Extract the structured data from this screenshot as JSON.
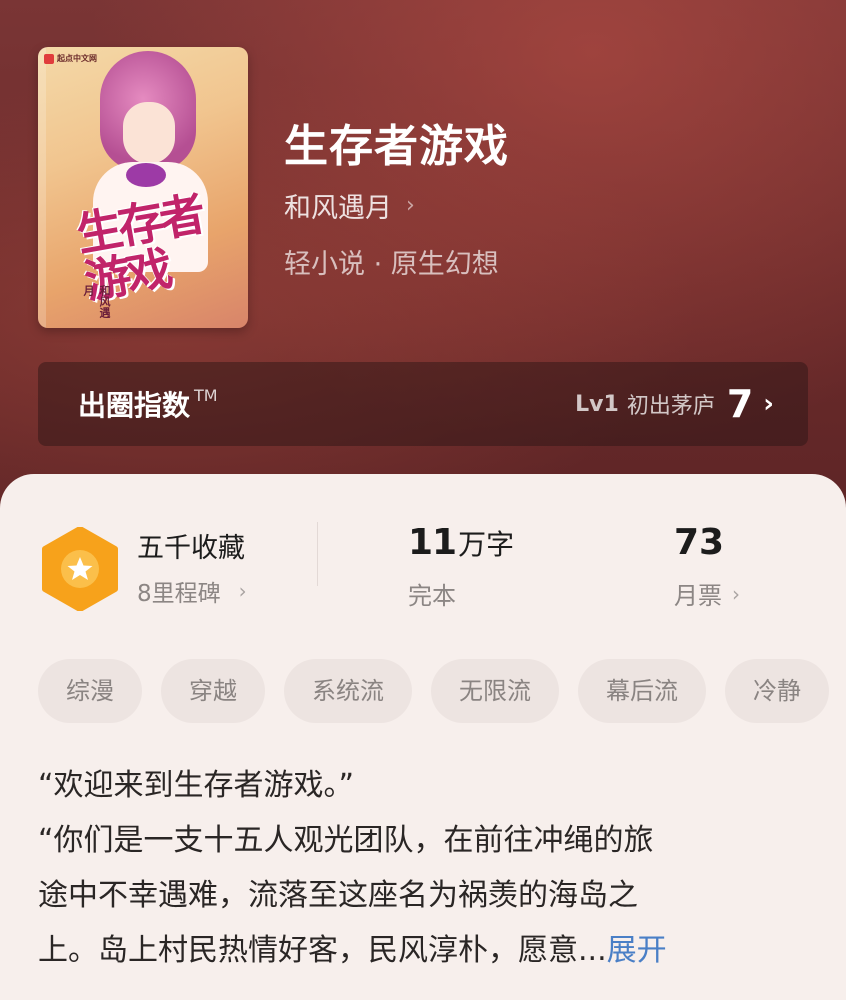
{
  "book": {
    "title": "生存者游戏",
    "author": "和风遇月",
    "genre": "轻小说 · 原生幻想",
    "cover": {
      "publisher_logo": "起点中文网",
      "title_art": "生存者游戏",
      "author_art": "和风遇月"
    }
  },
  "index_bar": {
    "label": "出圈指数",
    "trademark": "TM",
    "level": "Lv1",
    "level_name": "初出茅庐",
    "score": "7",
    "chevron": "›"
  },
  "stats": {
    "favorites_title": "五千收藏",
    "favorites_sub": "8里程碑",
    "word_count_number": "11",
    "word_count_unit": "万字",
    "status": "完本",
    "monthly_votes": "73",
    "monthly_votes_label": "月票",
    "chevron": "›"
  },
  "tags": [
    "综漫",
    "穿越",
    "系统流",
    "无限流",
    "幕后流",
    "冷静"
  ],
  "description": {
    "lines": [
      "“欢迎来到生存者游戏。”",
      "“你们是一支十五人观光团队，在前往冲绳的旅",
      "途中不幸遇难，流落至这座名为祸羡的海岛之",
      "上。岛上村民热情好客，民风淳朴，愿意..."
    ],
    "expand_label": "展开"
  },
  "colors": {
    "badge_orange": "#f7a21b",
    "link_blue": "#4a7fc6",
    "panel_bg": "#f7efec"
  },
  "icons": {
    "favorites_badge": "star-hexagon-icon",
    "chevron": "chevron-right-icon"
  }
}
